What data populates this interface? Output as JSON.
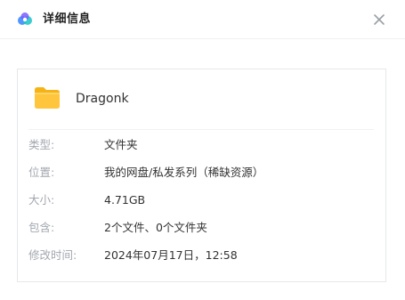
{
  "dialog": {
    "title": "详细信息",
    "app_icon": "cloud-logo-icon",
    "close_icon": "close-icon",
    "colors": {
      "folder": "#FFC53D",
      "label": "#A3A8B0",
      "border": "#E6E8EB"
    }
  },
  "file": {
    "icon": "folder-icon",
    "name": "Dragonk"
  },
  "details": [
    {
      "label": "类型:",
      "value": "文件夹"
    },
    {
      "label": "位置:",
      "value": "我的网盘/私发系列（稀缺资源）"
    },
    {
      "label": "大小:",
      "value": "4.71GB"
    },
    {
      "label": "包含:",
      "value": "2个文件、0个文件夹"
    },
    {
      "label": "修改时间:",
      "value": "2024年07月17日，12:58"
    }
  ]
}
